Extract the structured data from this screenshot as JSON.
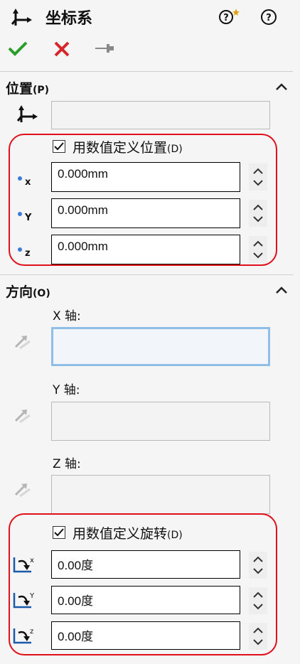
{
  "header": {
    "title": "坐标系",
    "ok_icon": "checkmark-icon",
    "cancel_icon": "close-icon",
    "pin_icon": "pushpin-icon",
    "help_icon": "help-star-icon",
    "help2_icon": "help-icon"
  },
  "position": {
    "title": "位置",
    "title_key": "(P)",
    "checkbox_label": "用数值定义位置",
    "checkbox_key": "(D)",
    "checked": true,
    "x_value": "0.000mm",
    "y_value": "0.000mm",
    "z_value": "0.000mm"
  },
  "orientation": {
    "title": "方向",
    "title_key": "(O)",
    "x_axis_label": "X 轴:",
    "y_axis_label": "Y 轴:",
    "z_axis_label": "Z 轴:",
    "checkbox_label": "用数值定义旋转",
    "checkbox_key": "(D)",
    "checked": true,
    "rot_x_value": "0.00度",
    "rot_y_value": "0.00度",
    "rot_z_value": "0.00度"
  },
  "colors": {
    "accent_blue": "#1a5aa8",
    "highlight_red": "#e0101a",
    "ok_green": "#2a9d2a",
    "cancel_red": "#d6262b"
  }
}
